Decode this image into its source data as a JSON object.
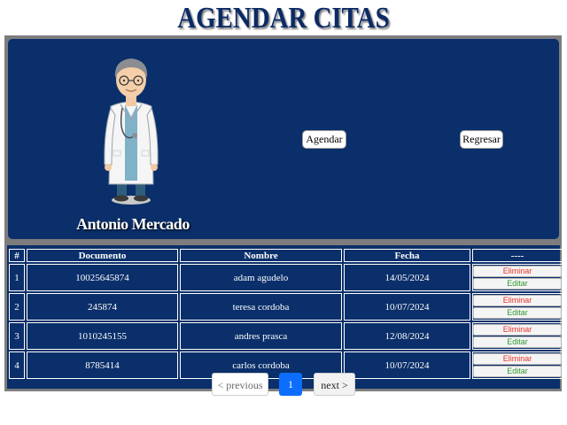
{
  "page": {
    "title": "AGENDAR CITAS"
  },
  "doctor": {
    "name": "Antonio Mercado"
  },
  "actions": {
    "agendar_label": "Agendar",
    "regresar_label": "Regresar"
  },
  "table": {
    "headers": {
      "num": "#",
      "documento": "Documento",
      "nombre": "Nombre",
      "fecha": "Fecha",
      "actions": "----"
    },
    "rows": [
      {
        "num": "1",
        "documento": "10025645874",
        "nombre": "adam agudelo",
        "fecha": "14/05/2024",
        "eliminar": "Eliminar",
        "editar": "Editar"
      },
      {
        "num": "2",
        "documento": "245874",
        "nombre": "teresa cordoba",
        "fecha": "10/07/2024",
        "eliminar": "Eliminar",
        "editar": "Editar"
      },
      {
        "num": "3",
        "documento": "1010245155",
        "nombre": "andres prasca",
        "fecha": "12/08/2024",
        "eliminar": "Eliminar",
        "editar": "Editar"
      },
      {
        "num": "4",
        "documento": "8785414",
        "nombre": "carlos cordoba",
        "fecha": "10/07/2024",
        "eliminar": "Eliminar",
        "editar": "Editar"
      }
    ]
  },
  "pagination": {
    "previous_label": "< previous",
    "current_page": "1",
    "next_label": "next >"
  },
  "colors": {
    "panel": "#0a2f6a",
    "title": "#0b2a66",
    "delete": "#e8332b",
    "edit": "#2f9a2f",
    "active_page": "#0d6efd"
  }
}
